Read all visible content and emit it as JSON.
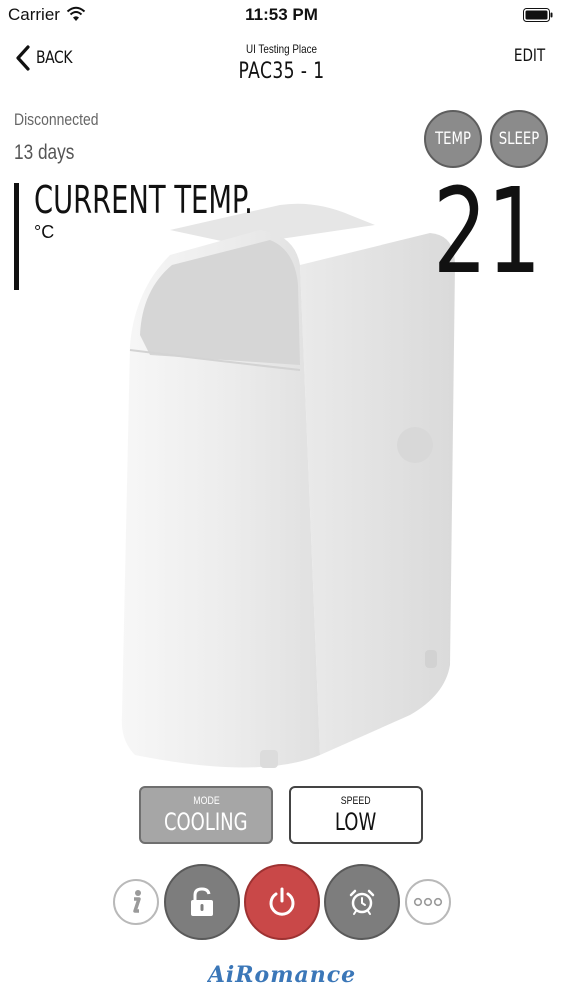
{
  "status_bar": {
    "carrier": "Carrier",
    "time": "11:53 PM"
  },
  "nav": {
    "back_label": "BACK",
    "subtitle": "UI Testing Place",
    "title": "PAC35 - 1",
    "edit_label": "EDIT"
  },
  "connection": {
    "status": "Disconnected",
    "duration": "13 days"
  },
  "header_buttons": {
    "temp": "TEMP",
    "sleep": "SLEEP"
  },
  "current_temp": {
    "heading": "CURRENT TEMP.",
    "unit": "°C",
    "value": "21"
  },
  "mode": {
    "caption": "MODE",
    "value": "COOLING"
  },
  "speed": {
    "caption": "SPEED",
    "value": "LOW"
  },
  "controls": {
    "info_icon": "info-icon",
    "lock_icon": "unlock-icon",
    "power_icon": "power-icon",
    "alarm_icon": "alarm-clock-icon",
    "more_icon": "more-icon"
  },
  "logo": {
    "text": "AiRomance"
  },
  "colors": {
    "power": "#c94848",
    "button_gray": "#7d7d7d",
    "mode_active": "#a6a6a6"
  }
}
